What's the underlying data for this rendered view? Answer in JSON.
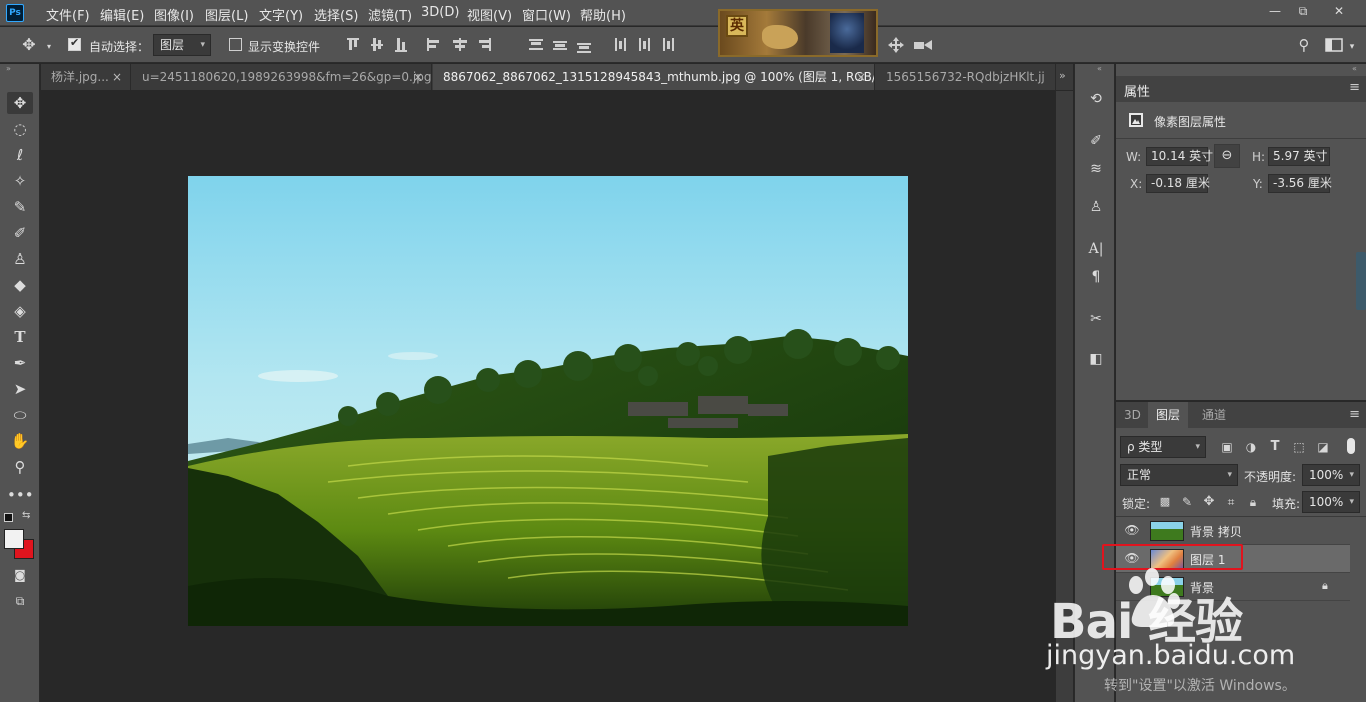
{
  "app": {
    "logo": "Ps"
  },
  "menu": [
    "文件(F)",
    "编辑(E)",
    "图像(I)",
    "图层(L)",
    "文字(Y)",
    "选择(S)",
    "滤镜(T)",
    "3D(D)",
    "视图(V)",
    "窗口(W)",
    "帮助(H)"
  ],
  "banner": {
    "glyph": "英"
  },
  "window_controls": {
    "minimize": "—",
    "restore": "⧉",
    "close": "✕"
  },
  "options": {
    "auto_select_label": "自动选择：",
    "auto_select_checked": true,
    "auto_select_target": "图层",
    "show_transform_label": "显示变换控件",
    "show_transform_checked": false
  },
  "tabs": [
    {
      "label": "杨洋.jpg...",
      "close": "×"
    },
    {
      "label": "u=2451180620,1989263998&fm=26&gp=0.jpg",
      "close": "×"
    },
    {
      "label": "8867062_8867062_1315128945843_mthumb.jpg @ 100% (图层 1, RGB/8) *",
      "close": "×",
      "active": true
    },
    {
      "label": "1565156732-RQdbjzHKlt.jj",
      "close": ""
    }
  ],
  "tab_overflow": "»",
  "properties": {
    "title": "属性",
    "subtitle": "像素图层属性",
    "w_label": "W:",
    "w_value": "10.14 英寸",
    "h_label": "H:",
    "h_value": "5.97 英寸",
    "x_label": "X:",
    "x_value": "-0.18 厘米",
    "y_label": "Y:",
    "y_value": "-3.56 厘米"
  },
  "layers_panel": {
    "tabs": [
      "3D",
      "图层",
      "通道"
    ],
    "active_tab": "图层",
    "filter": "ρ 类型",
    "blend_mode": "正常",
    "opacity_label": "不透明度:",
    "opacity_value": "100%",
    "lock_label": "锁定:",
    "fill_label": "填充:",
    "fill_value": "100%",
    "layers": [
      {
        "name": "背景 拷贝",
        "visible": true,
        "selected": false,
        "locked": false
      },
      {
        "name": "图层 1",
        "visible": true,
        "selected": true,
        "locked": false
      },
      {
        "name": "背景",
        "visible": false,
        "selected": false,
        "locked": true
      }
    ]
  },
  "watermark": {
    "logo": "Bai 经验",
    "url": "jingyan.baidu.com",
    "activate": "转到\"设置\"以激活 Windows。"
  },
  "colors": {
    "foreground": "#f2f2f2",
    "background": "#e0141e",
    "highlight_box": "#e0141e"
  }
}
